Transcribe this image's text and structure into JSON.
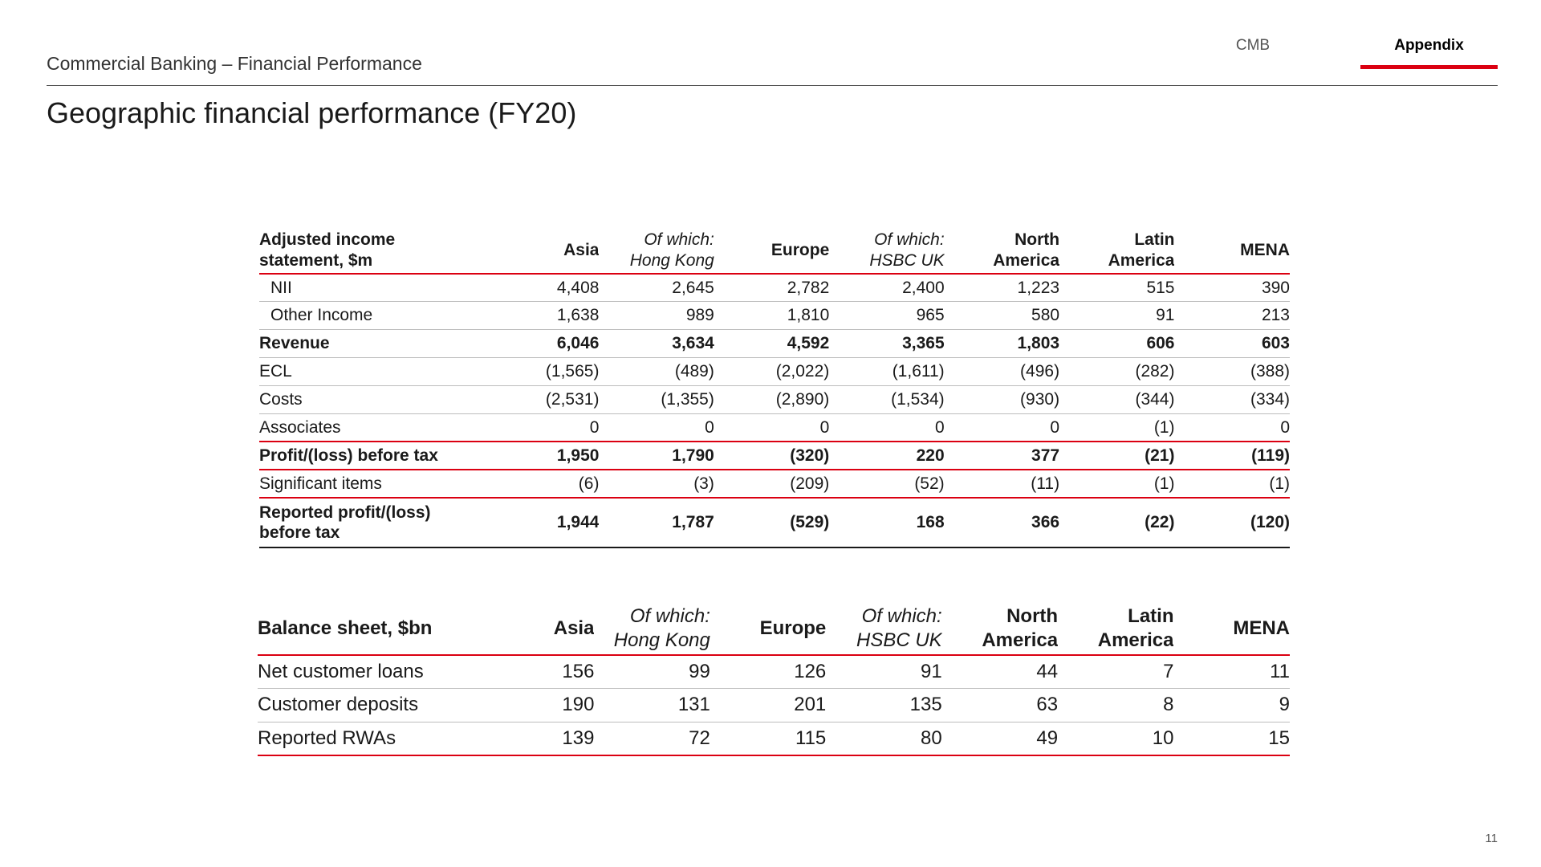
{
  "header": {
    "breadcrumb": "Commercial Banking – Financial Performance",
    "title": "Geographic financial performance (FY20)",
    "tabs": [
      {
        "label": "CMB",
        "active": false
      },
      {
        "label": "Appendix",
        "active": true
      }
    ],
    "accent_color": "#db0011"
  },
  "income_statement": {
    "heading_line1": "Adjusted income",
    "heading_line2": "statement, $m",
    "columns": [
      {
        "line1": "Asia",
        "line2": ""
      },
      {
        "line1": "Of which:",
        "line2": "Hong Kong"
      },
      {
        "line1": "Europe",
        "line2": ""
      },
      {
        "line1": "Of which:",
        "line2": "HSBC UK"
      },
      {
        "line1": "North",
        "line2": "America"
      },
      {
        "line1": "Latin",
        "line2": "America"
      },
      {
        "line1": "MENA",
        "line2": ""
      }
    ],
    "rows": [
      {
        "label": "NII",
        "values": [
          "4,408",
          "2,645",
          "2,782",
          "2,400",
          "1,223",
          "515",
          "390"
        ]
      },
      {
        "label": "Other Income",
        "values": [
          "1,638",
          "989",
          "1,810",
          "965",
          "580",
          "91",
          "213"
        ]
      },
      {
        "label": "Revenue",
        "values": [
          "6,046",
          "3,634",
          "4,592",
          "3,365",
          "1,803",
          "606",
          "603"
        ]
      },
      {
        "label": "ECL",
        "values": [
          "(1,565)",
          "(489)",
          "(2,022)",
          "(1,611)",
          "(496)",
          "(282)",
          "(388)"
        ]
      },
      {
        "label": "Costs",
        "values": [
          "(2,531)",
          "(1,355)",
          "(2,890)",
          "(1,534)",
          "(930)",
          "(344)",
          "(334)"
        ]
      },
      {
        "label": "Associates",
        "values": [
          "0",
          "0",
          "0",
          "0",
          "0",
          "(1)",
          "0"
        ]
      },
      {
        "label": "Profit/(loss) before tax",
        "values": [
          "1,950",
          "1,790",
          "(320)",
          "220",
          "377",
          "(21)",
          "(119)"
        ]
      },
      {
        "label": "Significant items",
        "values": [
          "(6)",
          "(3)",
          "(209)",
          "(52)",
          "(11)",
          "(1)",
          "(1)"
        ]
      },
      {
        "label_line1": "Reported profit/(loss)",
        "label_line2": "before tax",
        "values": [
          "1,944",
          "1,787",
          "(529)",
          "168",
          "366",
          "(22)",
          "(120)"
        ]
      }
    ]
  },
  "balance_sheet": {
    "heading": "Balance sheet, $bn",
    "columns": [
      {
        "line1": "Asia",
        "line2": ""
      },
      {
        "line1": "Of which:",
        "line2": "Hong Kong"
      },
      {
        "line1": "Europe",
        "line2": ""
      },
      {
        "line1": "Of which:",
        "line2": "HSBC UK"
      },
      {
        "line1": "North",
        "line2": "America"
      },
      {
        "line1": "Latin",
        "line2": "America"
      },
      {
        "line1": "MENA",
        "line2": ""
      }
    ],
    "rows": [
      {
        "label": "Net customer loans",
        "values": [
          "156",
          "99",
          "126",
          "91",
          "44",
          "7",
          "11"
        ]
      },
      {
        "label": "Customer deposits",
        "values": [
          "190",
          "131",
          "201",
          "135",
          "63",
          "8",
          "9"
        ]
      },
      {
        "label": "Reported RWAs",
        "values": [
          "139",
          "72",
          "115",
          "80",
          "49",
          "10",
          "15"
        ]
      }
    ]
  },
  "footer": {
    "page_number": "11"
  }
}
